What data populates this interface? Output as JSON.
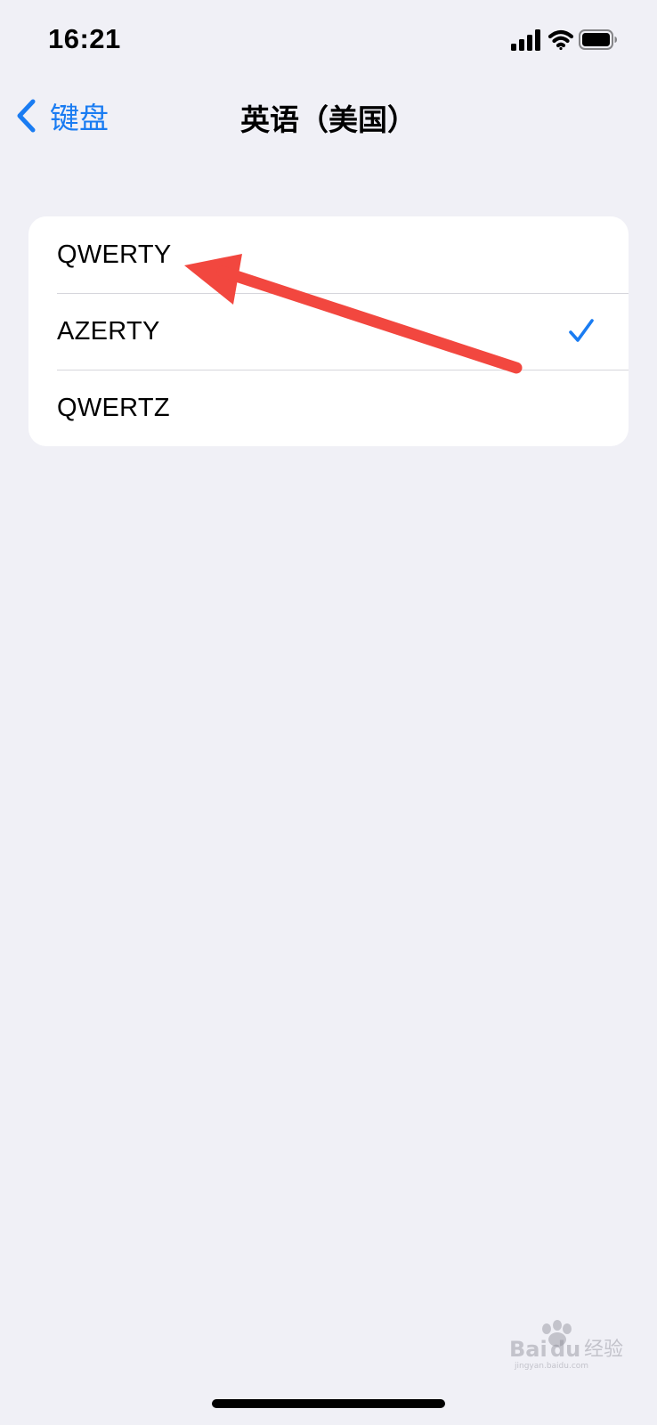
{
  "status_bar": {
    "time": "16:21",
    "icons": [
      "cellular-signal-icon",
      "wifi-icon",
      "battery-icon"
    ]
  },
  "nav": {
    "back_label": "键盘",
    "back_icon": "chevron-left-icon",
    "title": "英语（美国）"
  },
  "options": [
    {
      "label": "QWERTY",
      "selected": false
    },
    {
      "label": "AZERTY",
      "selected": true
    },
    {
      "label": "QWERTZ",
      "selected": false
    }
  ],
  "colors": {
    "accent": "#1a7cf2",
    "background": "#f0f0f6",
    "card": "#ffffff",
    "annotation_arrow": "#f2473f"
  },
  "annotation": {
    "icon": "red-arrow-annotation"
  },
  "watermark": {
    "logo": "Baidu 经验",
    "url": "jingyan.baidu.com"
  }
}
